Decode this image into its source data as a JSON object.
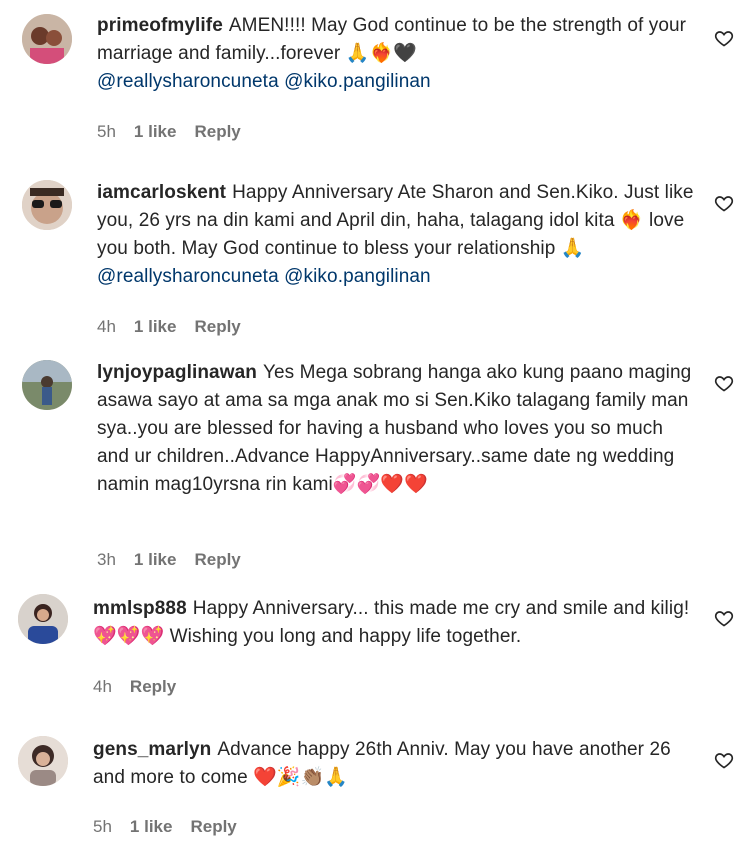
{
  "comments": [
    {
      "username": "primeofmylife",
      "text": "AMEN!!!! May God continue to be the strength of your marriage and family...forever 🙏❤️‍🔥🖤",
      "mentions": [
        "@reallysharoncuneta",
        "@kiko.pangilinan"
      ],
      "time": "5h",
      "likes": "1 like",
      "reply": "Reply"
    },
    {
      "username": "iamcarloskent",
      "text": "Happy Anniversary Ate Sharon and Sen.Kiko. Just like you, 26 yrs na din kami and April din, haha, talagang idol kita ❤️‍🔥 love you both. May God continue to bless your relationship 🙏",
      "mentions": [
        "@reallysharoncuneta",
        "@kiko.pangilinan"
      ],
      "time": "4h",
      "likes": "1 like",
      "reply": "Reply"
    },
    {
      "username": "lynjoypaglinawan",
      "text": "Yes Mega sobrang hanga ako kung paano maging asawa sayo at ama sa mga anak mo si Sen.Kiko talagang family man sya..you are blessed for having a husband who loves you so much and ur children..Advance HappyAnniversary..same date ng wedding namin mag10yrsna rin kami💞💞❤️❤️",
      "mentions": [],
      "time": "3h",
      "likes": "1 like",
      "reply": "Reply"
    },
    {
      "username": "mmlsp888",
      "text": "Happy Anniversary... this made me cry and smile and kilig! 💖💖💖 Wishing you long and happy life together.",
      "mentions": [],
      "time": "4h",
      "likes": "",
      "reply": "Reply"
    },
    {
      "username": "gens_marlyn",
      "text": "Advance happy 26th Anniv. May you have another 26 and more to come ❤️🎉👏🏽🙏",
      "mentions": [],
      "time": "5h",
      "likes": "1 like",
      "reply": "Reply"
    }
  ],
  "colors": {
    "text": "#262626",
    "meta": "#737373",
    "mention": "#00376b"
  },
  "icons": {
    "like": "heart-outline-icon"
  }
}
